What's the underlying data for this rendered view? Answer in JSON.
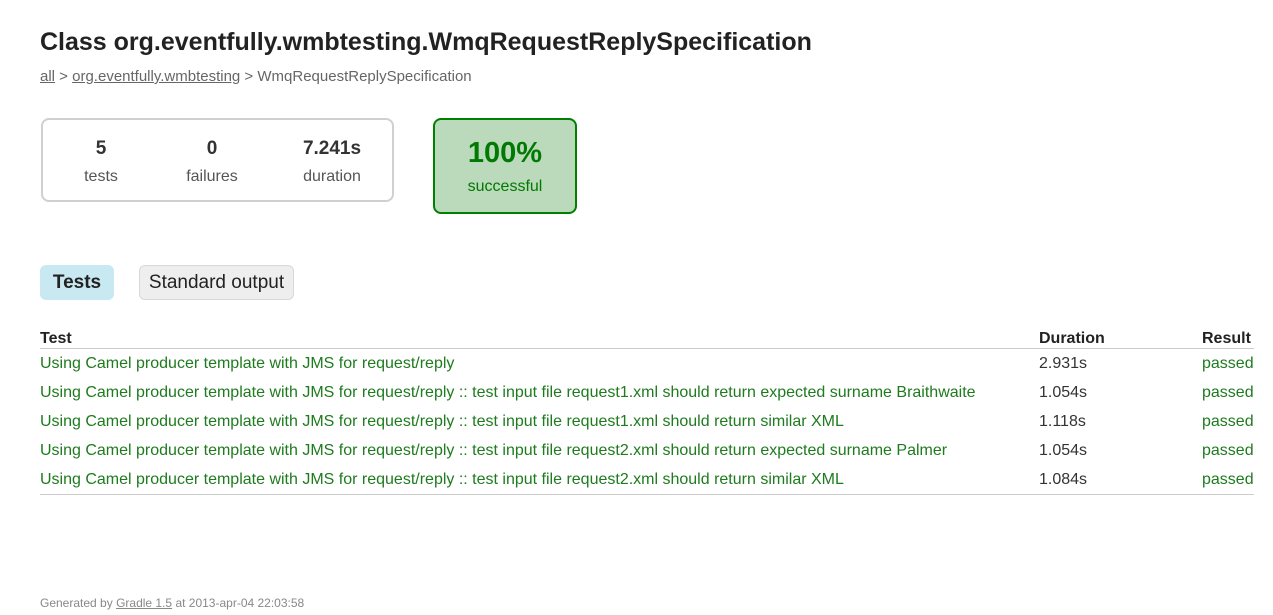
{
  "page": {
    "title": "Class org.eventfully.wmbtesting.WmqRequestReplySpecification"
  },
  "breadcrumb": {
    "all": "all",
    "sep1": " > ",
    "package": "org.eventfully.wmbtesting",
    "sep2": " > ",
    "current": "WmqRequestReplySpecification"
  },
  "summary": {
    "tests": "5",
    "tests_label": "tests",
    "failures": "0",
    "failures_label": "failures",
    "duration": "7.241s",
    "duration_label": "duration",
    "success_rate": "100%",
    "success_label": "successful"
  },
  "tabs": [
    {
      "label": "Tests",
      "selected": true
    },
    {
      "label": "Standard output",
      "selected": false
    }
  ],
  "table": {
    "headers": {
      "test": "Test",
      "duration": "Duration",
      "result": "Result"
    },
    "rows": [
      {
        "name": "Using Camel producer template with JMS for request/reply",
        "duration": "2.931s",
        "result": "passed"
      },
      {
        "name": "Using Camel producer template with JMS for request/reply :: test input file request1.xml should return expected surname Braithwaite",
        "duration": "1.054s",
        "result": "passed"
      },
      {
        "name": "Using Camel producer template with JMS for request/reply :: test input file request1.xml should return similar XML",
        "duration": "1.118s",
        "result": "passed"
      },
      {
        "name": "Using Camel producer template with JMS for request/reply :: test input file request2.xml should return expected surname Palmer",
        "duration": "1.054s",
        "result": "passed"
      },
      {
        "name": "Using Camel producer template with JMS for request/reply :: test input file request2.xml should return similar XML",
        "duration": "1.084s",
        "result": "passed"
      }
    ]
  },
  "footer": {
    "prefix": "Generated by ",
    "link": "Gradle 1.5",
    "suffix": " at 2013-apr-04 22:03:58"
  },
  "colors": {
    "passed_text": "#1e7b1e",
    "success_bg": "#bbd9bb",
    "success_border": "#008000",
    "selected_tab_bg": "#c8e9f2"
  }
}
